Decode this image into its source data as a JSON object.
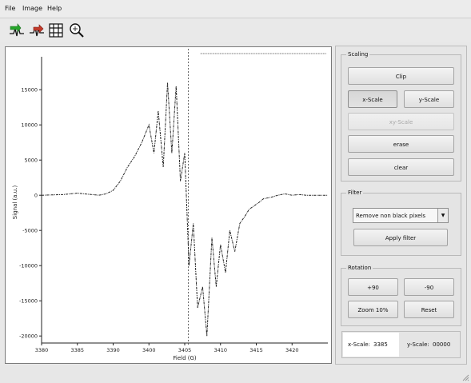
{
  "menu": {
    "items": [
      {
        "label": "File"
      },
      {
        "label": "Image"
      },
      {
        "label": "Help"
      }
    ]
  },
  "toolbar": {
    "tools": [
      {
        "icon": "green-arrow-signal-icon"
      },
      {
        "icon": "red-arrow-signal-icon"
      },
      {
        "icon": "film-frames-icon"
      },
      {
        "icon": "magnifier-settings-icon"
      }
    ]
  },
  "plot": {
    "ylabel": "Signal (a.u.)",
    "xlabel": "Field (G)",
    "yticks": [
      "15000",
      "10000",
      "5000",
      "0",
      "-5000",
      "-10000",
      "-15000",
      "-20000"
    ],
    "xticks": [
      "3380",
      "3385",
      "3390",
      "3400",
      "3405",
      "3410",
      "3415",
      "3420"
    ]
  },
  "chart_data": {
    "type": "line",
    "xlabel": "Field (G)",
    "ylabel": "Signal (a.u.)",
    "xlim": [
      3380,
      3420
    ],
    "ylim": [
      -21000,
      19000
    ],
    "grid": false,
    "series": [
      {
        "x": [
          3380,
          3383,
          3385,
          3387,
          3388,
          3389,
          3390,
          3391,
          3392,
          3393,
          3394,
          3395,
          3395.7,
          3396.3,
          3397,
          3397.6,
          3398.2,
          3398.8,
          3399.4,
          3400,
          3400.6,
          3401.2,
          3401.8,
          3402.5,
          3403.1,
          3403.8,
          3404.4,
          3405,
          3405.7,
          3406.3,
          3407,
          3407.7,
          3408.4,
          3409,
          3409.7,
          3410.4,
          3411,
          3412,
          3413,
          3414,
          3415,
          3416,
          3417,
          3418,
          3419,
          3420
        ],
        "y": [
          0,
          100,
          300,
          100,
          0,
          200,
          700,
          2000,
          4000,
          5500,
          7500,
          10000,
          6000,
          12000,
          4000,
          16000,
          6000,
          15500,
          2000,
          6000,
          -10000,
          -4000,
          -16000,
          -13000,
          -20000,
          -6000,
          -13000,
          -7000,
          -11000,
          -5000,
          -8000,
          -4000,
          -3000,
          -2000,
          -1500,
          -1000,
          -500,
          -300,
          0,
          200,
          0,
          100,
          0,
          0,
          0,
          0
        ]
      }
    ]
  },
  "scaling": {
    "title": "Scaling",
    "clip": "Clip",
    "x_scale": "x-Scale",
    "y_scale": "y-Scale",
    "xy_scale": "xy-Scale",
    "erase": "erase",
    "clear": "clear"
  },
  "filter": {
    "title": "Filter",
    "selected": "Remove non black pixels",
    "apply": "Apply filter"
  },
  "rotation": {
    "title": "Rotation",
    "plus90": "+90",
    "minus90": "-90",
    "zoom": "Zoom 10%",
    "reset": "Reset"
  },
  "status": {
    "x_label": "x-Scale:",
    "x_value": "3385",
    "y_label": "y-Scale:",
    "y_value": "00000"
  }
}
